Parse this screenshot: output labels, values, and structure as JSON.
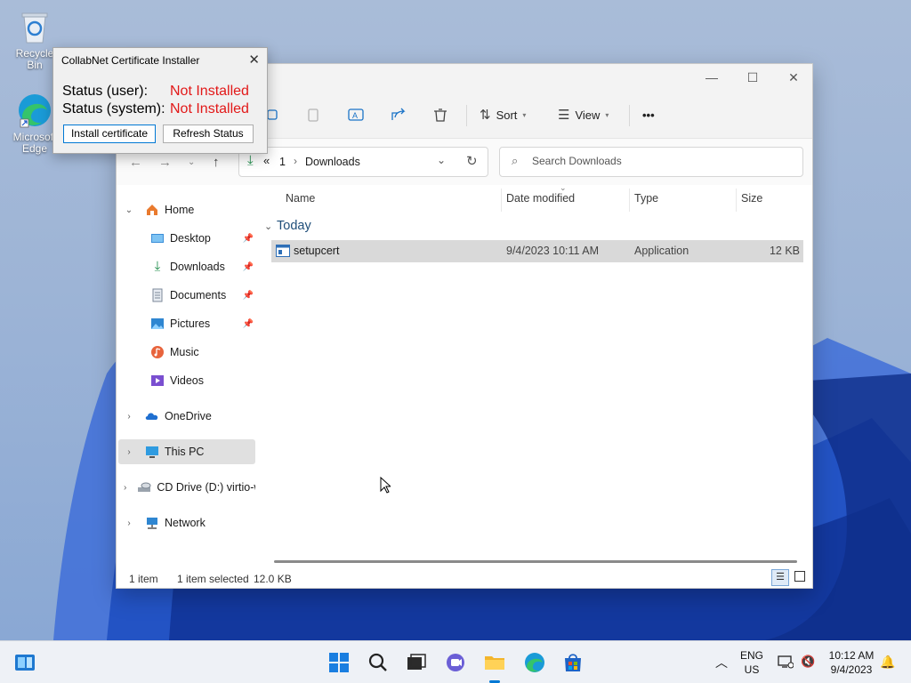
{
  "desktop": {
    "icons": [
      {
        "label": "Recycle Bin",
        "icon": "recycle-bin-icon"
      },
      {
        "label": "Microsoft Edge",
        "icon": "edge-icon"
      }
    ]
  },
  "dialog": {
    "title": "CollabNet Certificate Installer",
    "status_user_label": "Status (user):",
    "status_user_value": "Not Installed",
    "status_system_label": "Status (system):",
    "status_system_value": "Not Installed",
    "install_button": "Install certificate",
    "refresh_button": "Refresh Status",
    "status_color": "#e21818"
  },
  "explorer": {
    "toolbar": {
      "sort_label": "Sort",
      "view_label": "View",
      "more_label": "•••"
    },
    "address": {
      "overflow": "«",
      "crumbs": [
        "1",
        "Downloads"
      ]
    },
    "search": {
      "placeholder": "Search Downloads"
    },
    "nav": {
      "home": "Home",
      "pinned": [
        {
          "label": "Desktop",
          "icon": "desktop-folder-icon"
        },
        {
          "label": "Downloads",
          "icon": "downloads-folder-icon"
        },
        {
          "label": "Documents",
          "icon": "documents-folder-icon"
        },
        {
          "label": "Pictures",
          "icon": "pictures-folder-icon"
        },
        {
          "label": "Music",
          "icon": "music-folder-icon"
        },
        {
          "label": "Videos",
          "icon": "videos-folder-icon"
        }
      ],
      "onedrive": "OneDrive",
      "thispc": "This PC",
      "cddrive": "CD Drive (D:) virtio-win",
      "network": "Network"
    },
    "columns": {
      "name": "Name",
      "date": "Date modified",
      "type": "Type",
      "size": "Size"
    },
    "group": "Today",
    "files": [
      {
        "name": "setupcert",
        "date": "9/4/2023 10:11 AM",
        "type": "Application",
        "size": "12 KB"
      }
    ],
    "status": {
      "count": "1 item",
      "selected": "1 item selected",
      "size": "12.0 KB"
    }
  },
  "taskbar": {
    "lang_top": "ENG",
    "lang_bottom": "US",
    "time": "10:12 AM",
    "date": "9/4/2023"
  },
  "colors": {
    "accent": "#0078d4",
    "selection": "#d9d9d9"
  }
}
